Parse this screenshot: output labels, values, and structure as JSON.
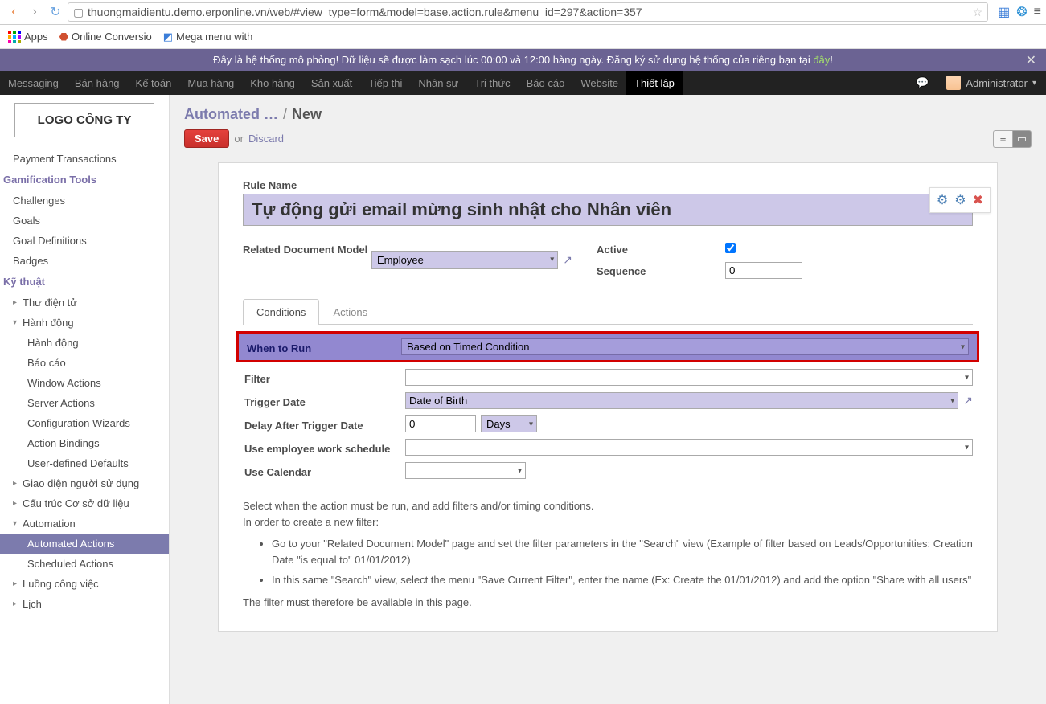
{
  "browser": {
    "url": "thuongmaidientu.demo.erponline.vn/web/#view_type=form&model=base.action.rule&menu_id=297&action=357",
    "bookmarks": {
      "apps": "Apps",
      "item1": "Online Conversio",
      "item2": "Mega menu with"
    }
  },
  "banner": {
    "text_pre": "Đây là hệ thống mô phỏng! Dữ liệu sẽ được làm sạch lúc 00:00 và 12:00 hàng ngày. Đăng ký sử dụng hệ thống của riêng bạn tại ",
    "link": "đây",
    "text_post": "!"
  },
  "topmenu": {
    "items": [
      "Messaging",
      "Bán hàng",
      "Kế toán",
      "Mua hàng",
      "Kho hàng",
      "Sản xuất",
      "Tiếp thị",
      "Nhân sự",
      "Tri thức",
      "Báo cáo",
      "Website",
      "Thiết lập"
    ],
    "user": "Administrator"
  },
  "sidebar": {
    "logo": "LOGO CÔNG TY",
    "top_item": "Payment Transactions",
    "section1": {
      "title": "Gamification Tools",
      "items": [
        "Challenges",
        "Goals",
        "Goal Definitions",
        "Badges"
      ]
    },
    "section2": {
      "title": "Kỹ thuật",
      "items": [
        "Thư điện tử",
        "Hành động",
        "Hành động",
        "Báo cáo",
        "Window Actions",
        "Server Actions",
        "Configuration Wizards",
        "Action Bindings",
        "User-defined Defaults",
        "Giao diện người sử dụng",
        "Cấu trúc Cơ sở dữ liệu",
        "Automation",
        "Automated Actions",
        "Scheduled Actions",
        "Luồng công việc",
        "Lịch"
      ]
    }
  },
  "page": {
    "breadcrumb_main": "Automated …",
    "breadcrumb_new": "New",
    "save": "Save",
    "or": "or",
    "discard": "Discard"
  },
  "form": {
    "rule_name_label": "Rule Name",
    "rule_name_value": "Tự động gửi email mừng sinh nhật cho Nhân viên",
    "related_model_label": "Related Document Model",
    "related_model_value": "Employee",
    "active_label": "Active",
    "active_value": true,
    "sequence_label": "Sequence",
    "sequence_value": "0",
    "tabs": {
      "conditions": "Conditions",
      "actions": "Actions"
    },
    "when_label": "When to Run",
    "when_value": "Based on Timed Condition",
    "filter_label": "Filter",
    "filter_value": "",
    "trigger_label": "Trigger Date",
    "trigger_value": "Date of Birth",
    "delay_label": "Delay After Trigger Date",
    "delay_value": "0",
    "delay_unit": "Days",
    "work_sched_label": "Use employee work schedule",
    "work_sched_value": "",
    "use_cal_label": "Use Calendar",
    "use_cal_value": "",
    "help1": "Select when the action must be run, and add filters and/or timing conditions.",
    "help2": "In order to create a new filter:",
    "help_li1": "Go to your \"Related Document Model\" page and set the filter parameters in the \"Search\" view (Example of filter based on Leads/Opportunities: Creation Date \"is equal to\" 01/01/2012)",
    "help_li2": "In this same \"Search\" view, select the menu \"Save Current Filter\", enter the name (Ex: Create the 01/01/2012) and add the option \"Share with all users\"",
    "help3": "The filter must therefore be available in this page."
  }
}
